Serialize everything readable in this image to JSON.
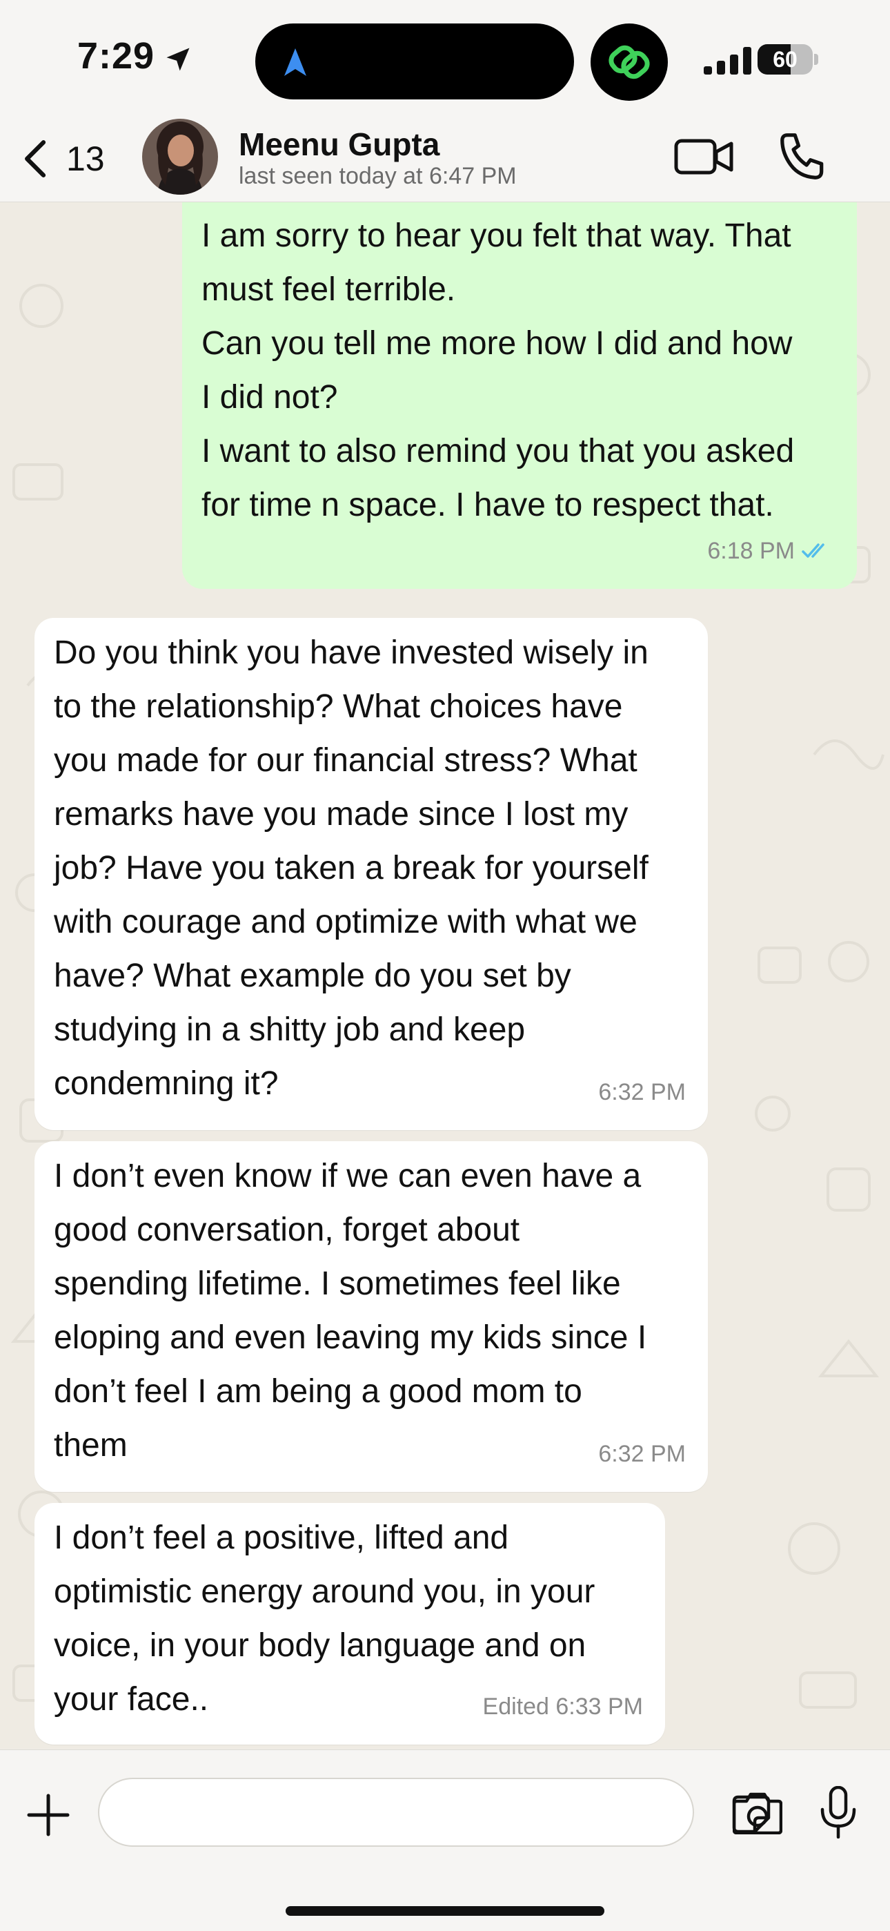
{
  "status_bar": {
    "time": "7:29",
    "battery": "60",
    "battery_level": 0.6
  },
  "header": {
    "back_count": "13",
    "contact_name": "Meenu Gupta",
    "last_seen": "last seen today at 6:47 PM"
  },
  "messages": [
    {
      "direction": "outgoing",
      "lines": [
        "I am sorry to hear you felt that way. That",
        "must feel terrible.",
        "Can you tell me more how I did and how",
        "I did not?",
        "I want to also remind you that you asked",
        "for time n space. I have to respect that."
      ],
      "time": "6:18 PM",
      "read": true
    },
    {
      "direction": "incoming",
      "lines": [
        "Do you think you have invested wisely in",
        "to the relationship? What choices have",
        "you made for our financial stress? What",
        "remarks have you made since I lost my",
        "job? Have you taken a break for yourself",
        "with courage and optimize with what we",
        "have? What example do you set by",
        "studying in a shitty job and keep",
        "condemning it?"
      ],
      "time": "6:32 PM"
    },
    {
      "direction": "incoming",
      "lines": [
        "I don’t even know if we can even have a",
        "good conversation, forget about",
        "spending lifetime. I sometimes feel like",
        "eloping and even leaving my kids since I",
        "don’t feel I am being a good mom to",
        "them"
      ],
      "time": "6:32 PM"
    },
    {
      "direction": "incoming",
      "lines": [
        "I don’t feel a positive, lifted and",
        "optimistic energy around you, in your",
        "voice, in your body language and on",
        "your face.."
      ],
      "time": "Edited 6:33 PM"
    }
  ],
  "composer": {
    "placeholder": "",
    "value": ""
  },
  "colors": {
    "outgoing_bubble": "#d9fdd3",
    "incoming_bubble": "#ffffff",
    "read_ticks": "#53bdeb",
    "link_badge_icon": "#3fd15a",
    "nav_arrow": "#3d8ef0"
  }
}
